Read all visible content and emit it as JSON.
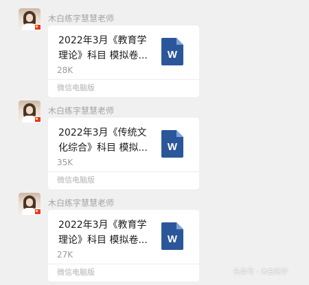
{
  "messages": [
    {
      "sender": "木白练字慧慧老师",
      "file_title": "2022年3月《教育学理论》科目 模拟卷...",
      "file_size": "28K",
      "file_type_letter": "W",
      "source": "微信电脑版"
    },
    {
      "sender": "木白练字慧慧老师",
      "file_title": "2022年3月《传统文化综合》科目 模拟...",
      "file_size": "35K",
      "file_type_letter": "W",
      "source": "微信电脑版"
    },
    {
      "sender": "木白练字慧慧老师",
      "file_title": "2022年3月《教育学理论》科目 模拟卷...",
      "file_size": "27K",
      "file_type_letter": "W",
      "source": "微信电脑版"
    }
  ],
  "watermark": "头条号 · 木白练字",
  "colors": {
    "word_icon": "#2b579a",
    "background": "#f0f0f0"
  }
}
